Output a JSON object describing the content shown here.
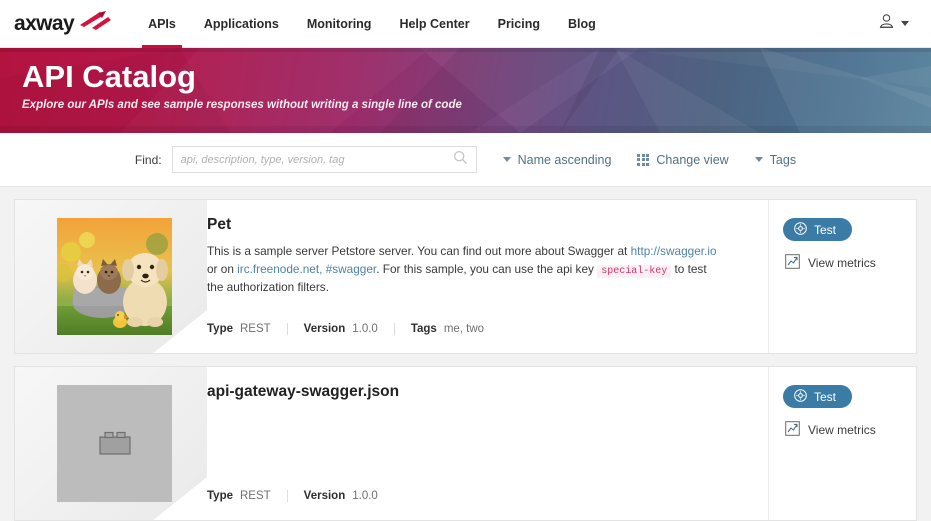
{
  "brand": {
    "name": "axway",
    "logo_icon": "axway-arrow-logo",
    "accent": "#c9103f"
  },
  "nav": {
    "items": [
      {
        "label": "APIs",
        "active": true
      },
      {
        "label": "Applications",
        "active": false
      },
      {
        "label": "Monitoring",
        "active": false
      },
      {
        "label": "Help Center",
        "active": false
      },
      {
        "label": "Pricing",
        "active": false
      },
      {
        "label": "Blog",
        "active": false
      }
    ],
    "user_menu": {
      "icon": "user-icon",
      "caret": "chevron-down-icon"
    }
  },
  "banner": {
    "title": "API Catalog",
    "subtitle": "Explore our APIs and see sample responses without writing a single line of code",
    "gradient_from": "#b3133f",
    "gradient_to": "#55809b"
  },
  "filterbar": {
    "find_label": "Find:",
    "search": {
      "placeholder": "api, description, type, version, tag",
      "value": "",
      "icon": "search-icon"
    },
    "controls": [
      {
        "label": "Name ascending",
        "icon": "chevron-down-icon"
      },
      {
        "label": "Change view",
        "icon": "grid-icon"
      },
      {
        "label": "Tags",
        "icon": "chevron-down-icon"
      }
    ],
    "link_color": "#517185"
  },
  "cards": [
    {
      "title": "Pet",
      "media_type": "photo",
      "media_alt": "kittens-and-puppy-photo",
      "description_parts": [
        {
          "type": "text",
          "text": "This is a sample server Petstore server. You can find out more about Swagger at "
        },
        {
          "type": "link",
          "text": "http://swagger.io"
        },
        {
          "type": "text",
          "text": " or on "
        },
        {
          "type": "link",
          "text": "irc.freenode.net, #swagger"
        },
        {
          "type": "text",
          "text": ". For this sample, you can use the api key "
        },
        {
          "type": "code",
          "text": "special-key"
        },
        {
          "type": "text",
          "text": " to test the authorization filters."
        }
      ],
      "meta": [
        {
          "label": "Type",
          "value": "REST"
        },
        {
          "label": "Version",
          "value": "1.0.0"
        },
        {
          "label": "Tags",
          "value": "me, two"
        }
      ],
      "actions": {
        "test_label": "Test",
        "test_icon": "gear-icon",
        "metrics_label": "View metrics",
        "metrics_icon": "chart-icon"
      }
    },
    {
      "title": "api-gateway-swagger.json",
      "media_type": "placeholder",
      "media_alt": "brick-placeholder-icon",
      "description_parts": [],
      "meta": [
        {
          "label": "Type",
          "value": "REST"
        },
        {
          "label": "Version",
          "value": "1.0.0"
        }
      ],
      "actions": {
        "test_label": "Test",
        "test_icon": "gear-icon",
        "metrics_label": "View metrics",
        "metrics_icon": "chart-icon"
      }
    }
  ],
  "colors": {
    "button_blue": "#3a7ca5",
    "code_pink": "#d6336c",
    "link_blue": "#4f83a8"
  }
}
